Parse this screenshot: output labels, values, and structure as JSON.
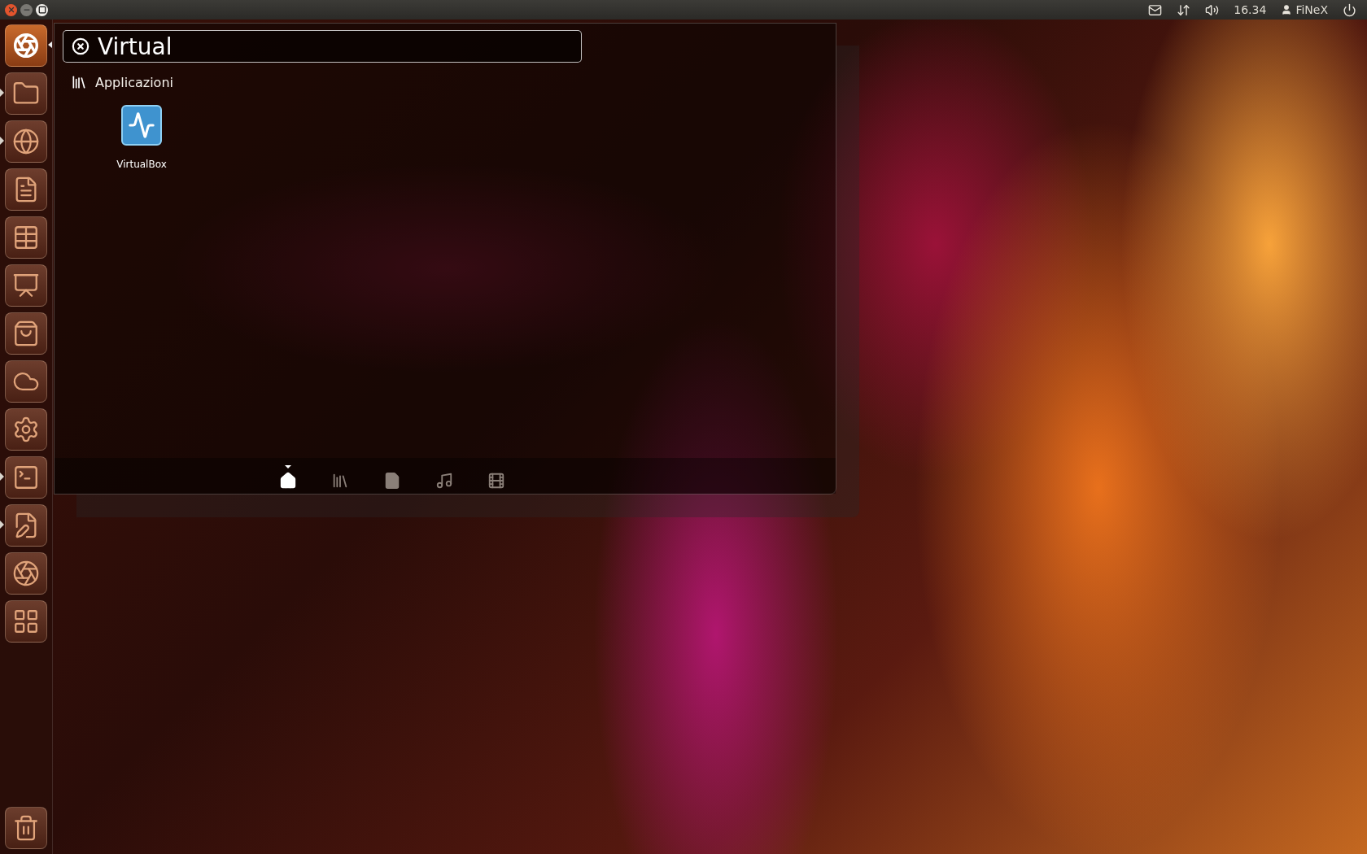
{
  "window_controls": [
    {
      "kind": "close"
    },
    {
      "kind": "minimize"
    },
    {
      "kind": "maximize"
    }
  ],
  "top_panel": {
    "time": "16.34",
    "user": "FiNeX"
  },
  "launcher": {
    "items": [
      {
        "kind": "home",
        "running": false,
        "active": true
      },
      {
        "kind": "folder",
        "running": true,
        "active": false
      },
      {
        "kind": "browser",
        "running": true,
        "active": false
      },
      {
        "kind": "document",
        "running": false,
        "active": false
      },
      {
        "kind": "spreadsheet",
        "running": false,
        "active": false
      },
      {
        "kind": "presentation",
        "running": false,
        "active": false
      },
      {
        "kind": "bag",
        "running": false,
        "active": false
      },
      {
        "kind": "cloud",
        "running": false,
        "active": false
      },
      {
        "kind": "settings",
        "running": false,
        "active": false
      },
      {
        "kind": "terminal",
        "running": true,
        "active": false
      },
      {
        "kind": "editor",
        "running": true,
        "active": false
      },
      {
        "kind": "photos",
        "running": false,
        "active": false
      },
      {
        "kind": "workspaces",
        "running": false,
        "active": false
      }
    ],
    "trash": {
      "kind": "trash"
    }
  },
  "dash": {
    "search": {
      "value": "Virtual"
    },
    "category": "Applicazioni",
    "results": [
      {
        "label": "VirtualBox"
      }
    ],
    "lenses": [
      {
        "kind": "home",
        "selected": true
      },
      {
        "kind": "apps",
        "selected": false
      },
      {
        "kind": "files",
        "selected": false
      },
      {
        "kind": "music",
        "selected": false
      },
      {
        "kind": "video",
        "selected": false
      }
    ]
  }
}
